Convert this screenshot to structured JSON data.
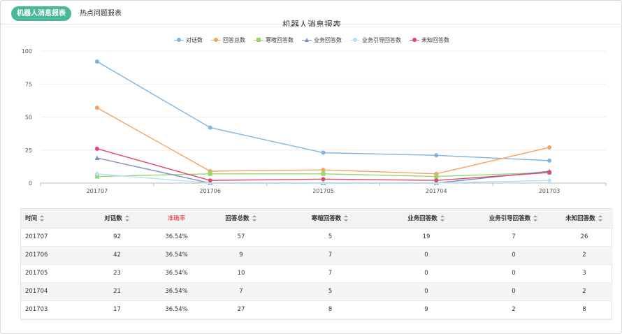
{
  "tabs": {
    "active_label": "机器人消息报表",
    "other_label": "热点问题报表"
  },
  "colors": {
    "accent": "#4cb89a",
    "danger": "#e8303a"
  },
  "chart_data": {
    "type": "line",
    "title": "机器人消息报表",
    "xlabel": "",
    "ylabel": "",
    "categories": [
      "201707",
      "201706",
      "201705",
      "201704",
      "201703"
    ],
    "ylim": [
      0,
      100
    ],
    "yticks": [
      0,
      25,
      50,
      75,
      100
    ],
    "grid": true,
    "legend_position": "top-center",
    "series": [
      {
        "name": "对话数",
        "color": "#7fb5e2",
        "marker": "circle",
        "values": [
          92,
          42,
          23,
          21,
          17
        ]
      },
      {
        "name": "回答总数",
        "color": "#f2a561",
        "marker": "circle",
        "values": [
          57,
          9,
          10,
          7,
          27
        ]
      },
      {
        "name": "寒暄回答数",
        "color": "#93d96e",
        "marker": "square",
        "values": [
          5,
          7,
          7,
          5,
          8
        ]
      },
      {
        "name": "业务回答数",
        "color": "#7d8fc4",
        "marker": "triangle",
        "values": [
          19,
          0,
          0,
          0,
          9
        ]
      },
      {
        "name": "业务引导回答数",
        "color": "#b3e3ef",
        "marker": "diamond",
        "values": [
          7,
          0,
          0,
          0,
          2
        ]
      },
      {
        "name": "未知回答数",
        "color": "#e0476e",
        "marker": "circle",
        "values": [
          26,
          2,
          3,
          2,
          8
        ]
      }
    ]
  },
  "table": {
    "headers": [
      {
        "label": "时间",
        "sortable": true
      },
      {
        "label": "对话数",
        "sortable": true
      },
      {
        "label": "准确率",
        "sortable": false
      },
      {
        "label": "回答总数",
        "sortable": true
      },
      {
        "label": "寒暄回答数",
        "sortable": true
      },
      {
        "label": "业务回答数",
        "sortable": true
      },
      {
        "label": "业务引导回答数",
        "sortable": true
      },
      {
        "label": "未知回答数",
        "sortable": true
      }
    ],
    "rows": [
      [
        "201707",
        "92",
        "36.54%",
        "57",
        "5",
        "19",
        "7",
        "26"
      ],
      [
        "201706",
        "42",
        "36.54%",
        "9",
        "7",
        "0",
        "0",
        "2"
      ],
      [
        "201705",
        "23",
        "36.54%",
        "10",
        "7",
        "0",
        "0",
        "3"
      ],
      [
        "201704",
        "21",
        "36.54%",
        "7",
        "5",
        "0",
        "0",
        "2"
      ],
      [
        "201703",
        "17",
        "36.54%",
        "27",
        "8",
        "9",
        "2",
        "8"
      ]
    ]
  }
}
